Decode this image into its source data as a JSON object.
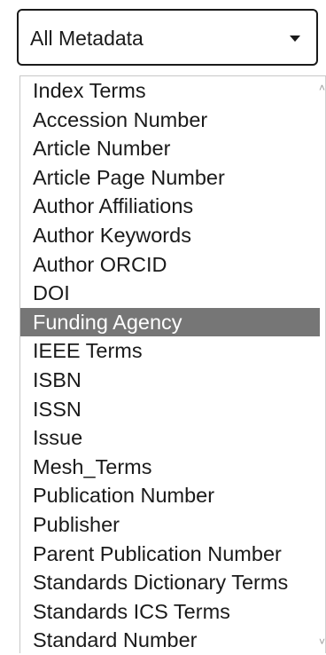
{
  "select": {
    "value": "All Metadata"
  },
  "options": [
    {
      "label": "Index Terms",
      "selected": false
    },
    {
      "label": "Accession Number",
      "selected": false
    },
    {
      "label": "Article Number",
      "selected": false
    },
    {
      "label": "Article Page Number",
      "selected": false
    },
    {
      "label": "Author Affiliations",
      "selected": false
    },
    {
      "label": "Author Keywords",
      "selected": false
    },
    {
      "label": "Author ORCID",
      "selected": false
    },
    {
      "label": "DOI",
      "selected": false
    },
    {
      "label": "Funding Agency",
      "selected": true
    },
    {
      "label": "IEEE Terms",
      "selected": false
    },
    {
      "label": "ISBN",
      "selected": false
    },
    {
      "label": "ISSN",
      "selected": false
    },
    {
      "label": "Issue",
      "selected": false
    },
    {
      "label": "Mesh_Terms",
      "selected": false
    },
    {
      "label": "Publication Number",
      "selected": false
    },
    {
      "label": "Publisher",
      "selected": false
    },
    {
      "label": "Parent Publication Number",
      "selected": false
    },
    {
      "label": "Standards Dictionary Terms",
      "selected": false
    },
    {
      "label": "Standards ICS Terms",
      "selected": false
    },
    {
      "label": "Standard Number",
      "selected": false
    }
  ],
  "colors": {
    "highlight": "#767676",
    "text": "#1a1a1a"
  }
}
